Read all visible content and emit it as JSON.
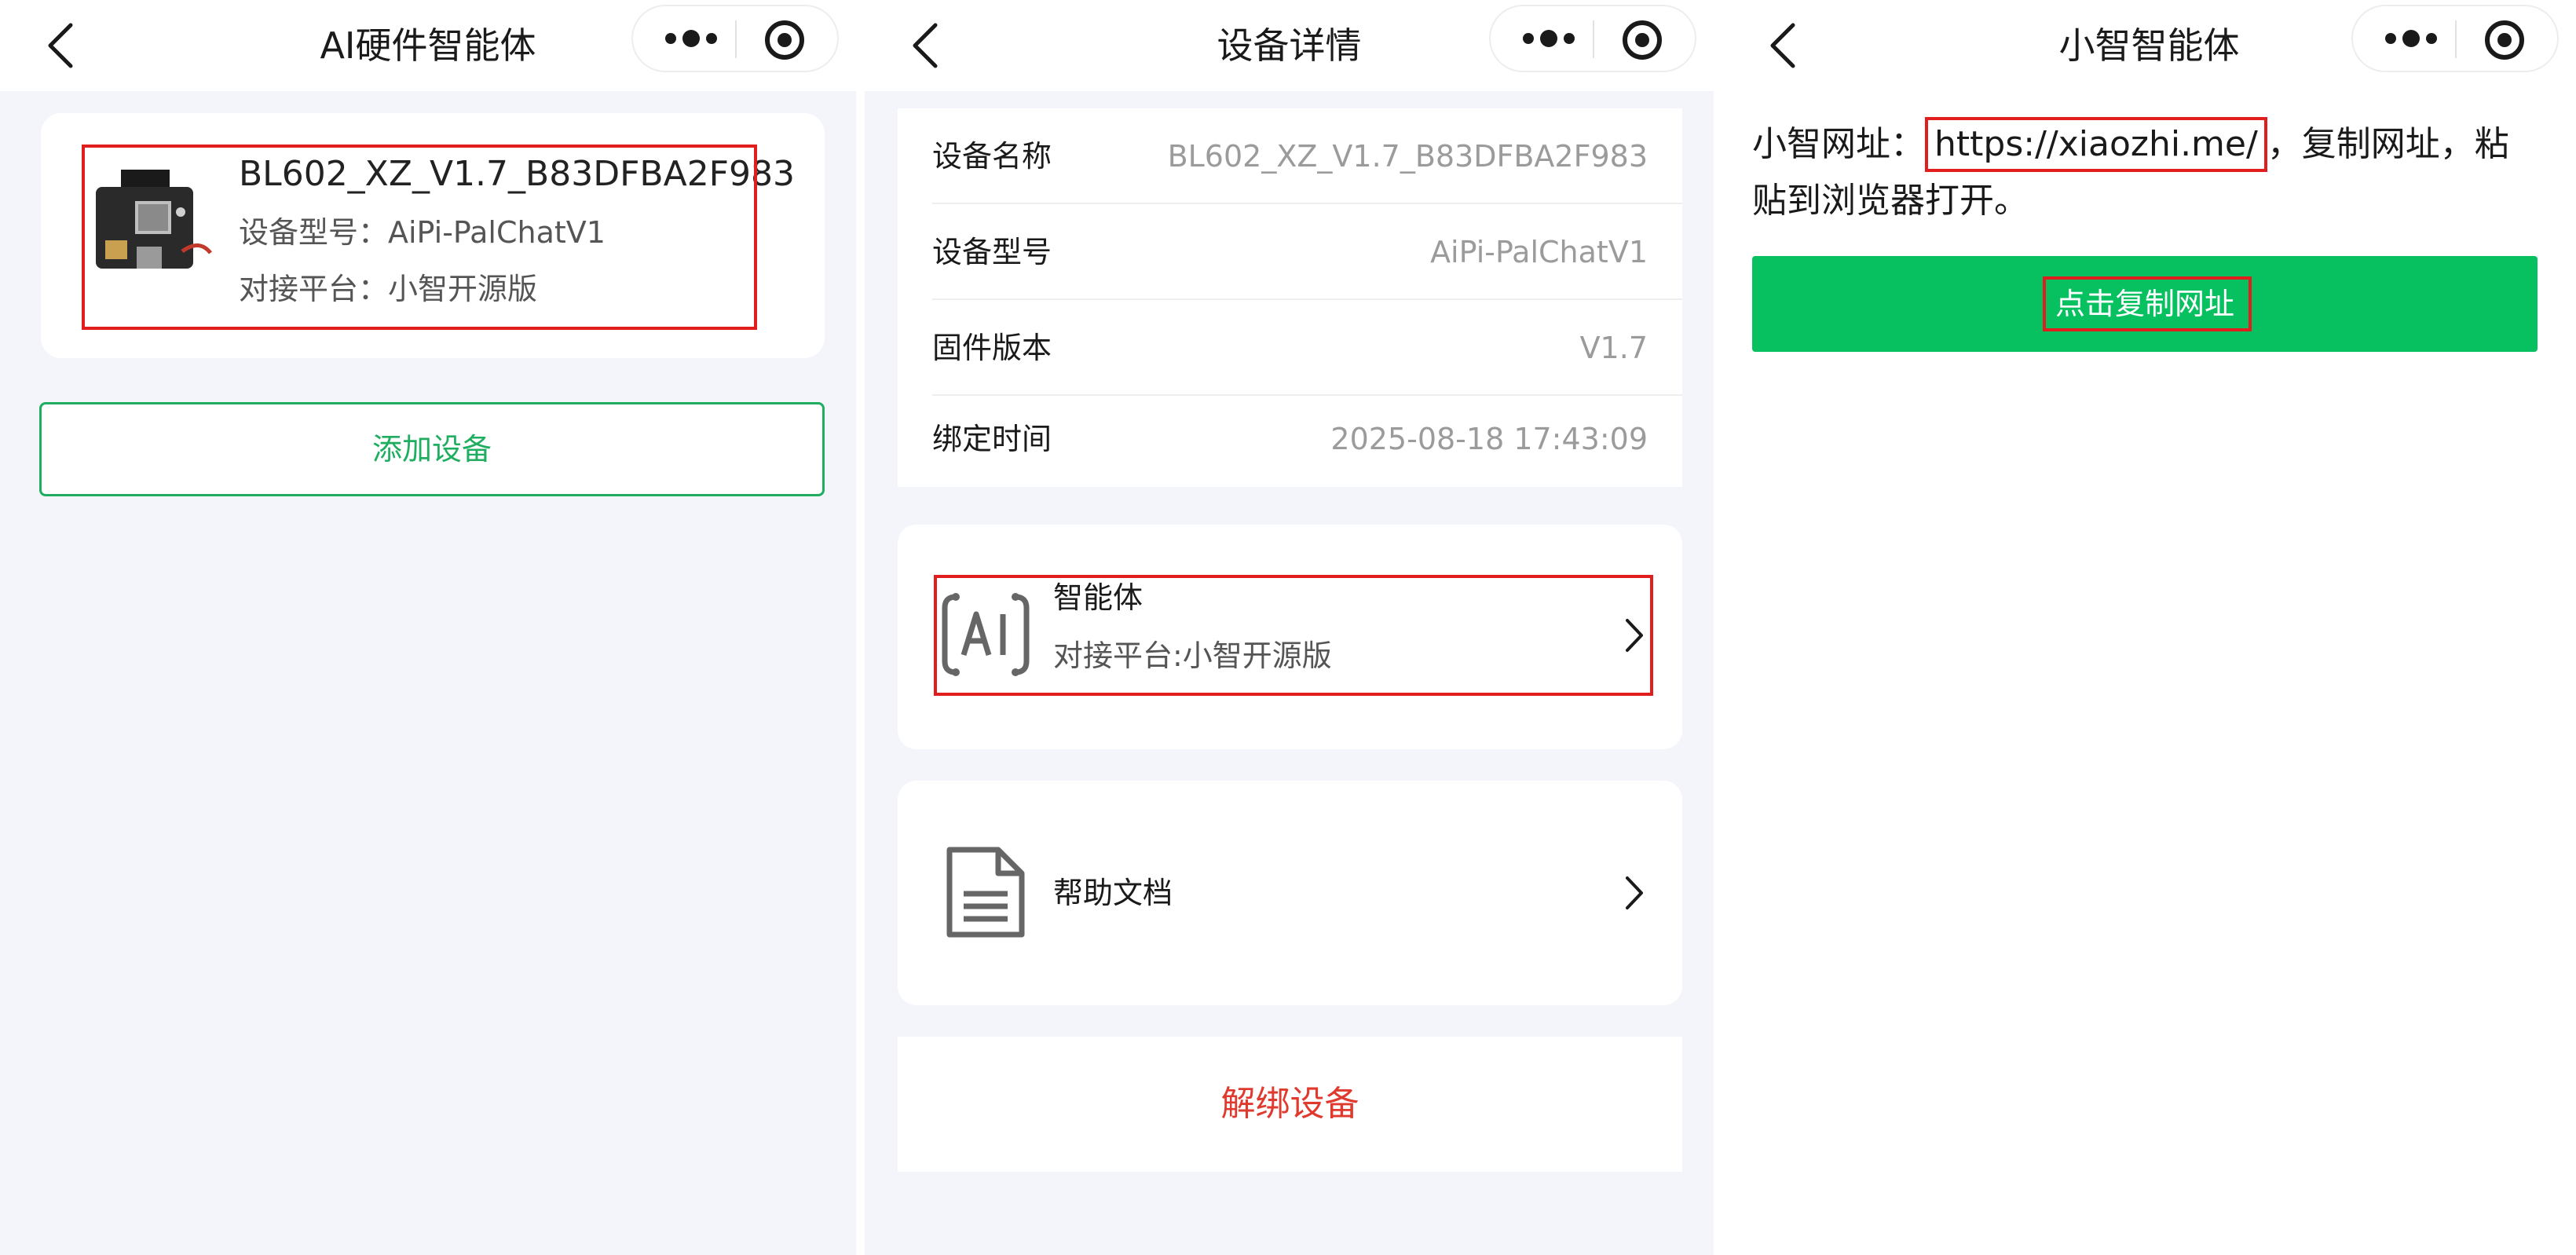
{
  "colors": {
    "accent_green": "#1fae60",
    "button_green": "#07c160",
    "danger_red": "#e03a2f",
    "highlight_red": "#e01e1e",
    "background": "#f3f5fb"
  },
  "panel1": {
    "title": "AI硬件智能体",
    "device": {
      "name": "BL602_XZ_V1.7_B83DFBA2F983",
      "model_line": "设备型号：AiPi-PalChatV1",
      "platform_line": "对接平台：小智开源版"
    },
    "add_device_label": "添加设备"
  },
  "panel2": {
    "title": "设备详情",
    "rows": [
      {
        "label": "设备名称",
        "value": "BL602_XZ_V1.7_B83DFBA2F983"
      },
      {
        "label": "设备型号",
        "value": "AiPi-PalChatV1"
      },
      {
        "label": "固件版本",
        "value": "V1.7"
      },
      {
        "label": "绑定时间",
        "value": "2025-08-18 17:43:09"
      }
    ],
    "agent": {
      "title": "智能体",
      "subtitle": "对接平台:小智开源版"
    },
    "help_doc": "帮助文档",
    "unbind_label": "解绑设备"
  },
  "panel3": {
    "title": "小智智能体",
    "text_prefix": "小智网址：",
    "url": "https://xiaozhi.me/",
    "text_suffix": "，复制网址，粘贴到浏览器打开。",
    "copy_button": "点击复制网址"
  },
  "icons": [
    "back-icon",
    "more-icon",
    "target-icon",
    "chevron-right-icon",
    "ai-agent-icon",
    "document-icon",
    "device-board-icon"
  ]
}
